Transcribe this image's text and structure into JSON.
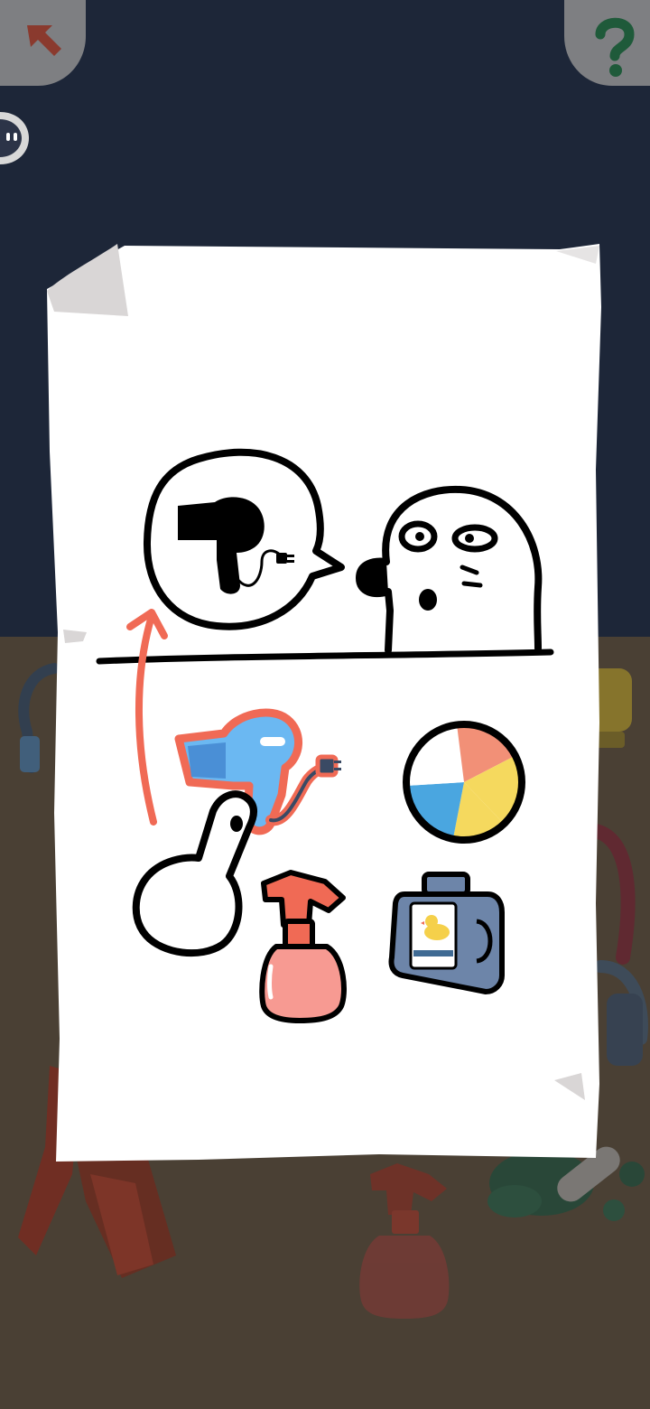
{
  "colors": {
    "wall": "#1d2638",
    "floor": "#4a4034",
    "paper": "#ffffff",
    "arrow": "#f06a55",
    "ink": "#000000",
    "back_arrow": "#8a3a2e",
    "help_mark": "#1f5a3a",
    "corner_button": "#8f8f8f",
    "hair_dryer": "#6bb8f2",
    "spray_bottle": "#f79a92",
    "detergent": "#6d85a9"
  },
  "icons": {
    "back": "back-arrow-icon",
    "help": "question-mark-icon",
    "side": "face-button-icon",
    "hint_items": [
      "hair-dryer-icon",
      "beach-ball-icon",
      "spray-bottle-icon",
      "detergent-bottle-icon"
    ]
  },
  "hint": {
    "speech_bubble_item": "hair-dryer-icon",
    "target_item": "hair-dryer-icon",
    "gesture": "drag-item-to-bubble"
  }
}
